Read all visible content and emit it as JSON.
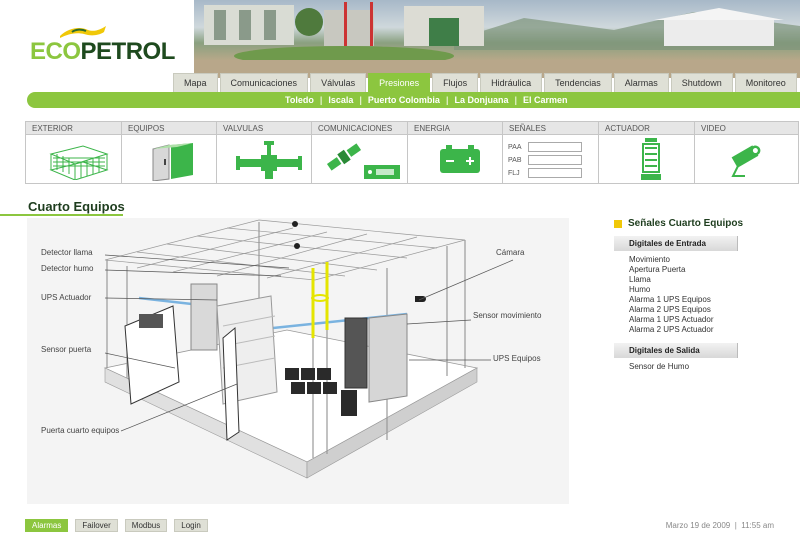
{
  "brand": {
    "logo_eco": "ECO",
    "logo_petrol": "PETROL",
    "accent": "#8cc63f"
  },
  "nav": {
    "tabs": [
      "Mapa",
      "Comunicaciones",
      "Válvulas",
      "Presiones",
      "Flujos",
      "Hidráulica",
      "Tendencias",
      "Alarmas",
      "Shutdown",
      "Monitoreo"
    ],
    "active": "Presiones"
  },
  "subnav": {
    "items": [
      "Toledo",
      "Iscala",
      "Puerto Colombia",
      "La Donjuana",
      "El Carmen"
    ]
  },
  "categories": {
    "exterior": "EXTERIOR",
    "equipos": "EQUIPOS",
    "valvulas": "VALVULAS",
    "comunicaciones": "COMUNICACIONES",
    "energia": "ENERGIA",
    "senales": "SEÑALES",
    "actuador": "ACTUADOR",
    "video": "VIDEO"
  },
  "senales_fields": [
    "PAA",
    "PAB",
    "FLJ"
  ],
  "section_title": "Cuarto Equipos",
  "diagram_labels": {
    "detector_llama": "Detector llama",
    "detector_humo": "Detector humo",
    "ups_actuador": "UPS Actuador",
    "sensor_puerta": "Sensor puerta",
    "puerta": "Puerta cuarto equipos",
    "camara": "Cámara",
    "sensor_movimiento": "Sensor movimiento",
    "ups_equipos": "UPS Equipos"
  },
  "signals_panel": {
    "title": "Señales Cuarto Equipos",
    "digitales_entrada": {
      "header": "Digitales de Entrada",
      "items": [
        "Movimiento",
        "Apertura Puerta",
        "Llama",
        "Humo",
        "Alarma 1 UPS Equipos",
        "Alarma 2 UPS Equipos",
        "Alarma 1 UPS Actuador",
        "Alarma 2 UPS Actuador"
      ]
    },
    "digitales_salida": {
      "header": "Digitales de Salida",
      "items": [
        "Sensor de Humo"
      ]
    }
  },
  "footer": {
    "buttons": [
      "Alarmas",
      "Failover",
      "Modbus",
      "Login"
    ],
    "active": "Alarmas",
    "date": "Marzo 19 de 2009",
    "time": "11:55 am"
  }
}
